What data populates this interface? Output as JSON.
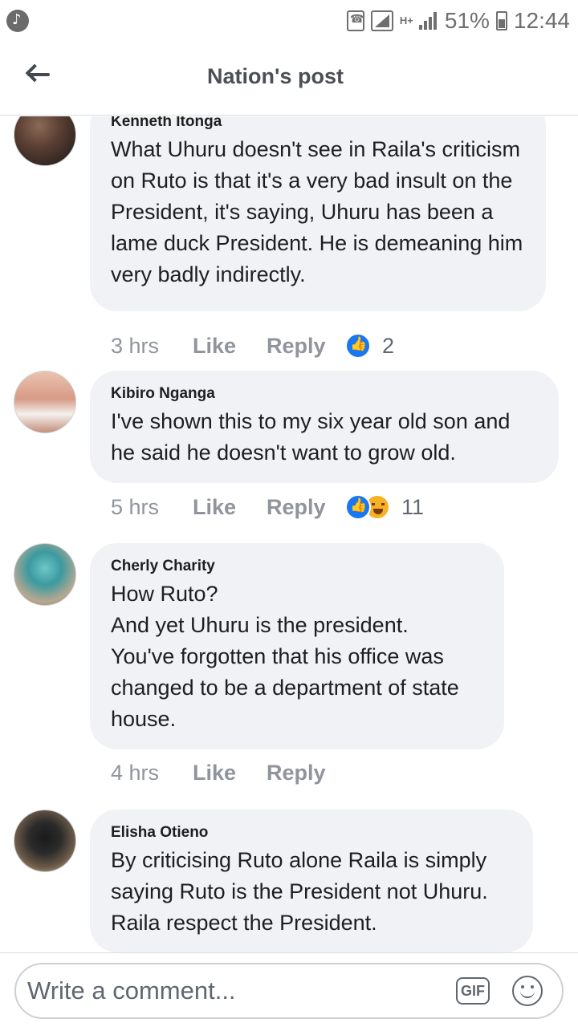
{
  "status_bar": {
    "network": "H+",
    "battery_percent": "51%",
    "battery_level": 0.51,
    "time": "12:44"
  },
  "header": {
    "title": "Nation's post",
    "back_icon": "back-arrow-icon"
  },
  "comments": [
    {
      "author": "Kenneth Itonga",
      "text": "What Uhuru doesn't see in Raila's criticism on Ruto is that it's a very bad insult on the President, it's saying, Uhuru has been a lame duck President. He is demeaning him very badly indirectly.",
      "time": "3 hrs",
      "like_label": "Like",
      "reply_label": "Reply",
      "reactions": [
        "like"
      ],
      "reaction_count": "2"
    },
    {
      "author": "Kibiro Nganga",
      "text": "I've shown this to my six year old son and he said he doesn't want to grow old.",
      "time": "5 hrs",
      "like_label": "Like",
      "reply_label": "Reply",
      "reactions": [
        "like",
        "haha"
      ],
      "reaction_count": "11"
    },
    {
      "author": "Cherly Charity",
      "text": "How Ruto?\nAnd yet Uhuru is the president.\nYou've forgotten that his office was changed to be a department of state house.",
      "time": "4 hrs",
      "like_label": "Like",
      "reply_label": "Reply",
      "reactions": [],
      "reaction_count": ""
    },
    {
      "author": "Elisha Otieno",
      "text": "By criticising Ruto alone Raila is simply saying Ruto is the President not Uhuru.\nRaila  respect  the President.",
      "time": "",
      "like_label": "",
      "reply_label": "",
      "reactions": [],
      "reaction_count": ""
    }
  ],
  "composer": {
    "placeholder": "Write a comment...",
    "gif_label": "GIF",
    "emoji_icon": "emoji-smile-icon"
  },
  "colors": {
    "bubble": "#f0f2f5",
    "like_blue": "#1877f2",
    "muted_text": "#90949c"
  }
}
